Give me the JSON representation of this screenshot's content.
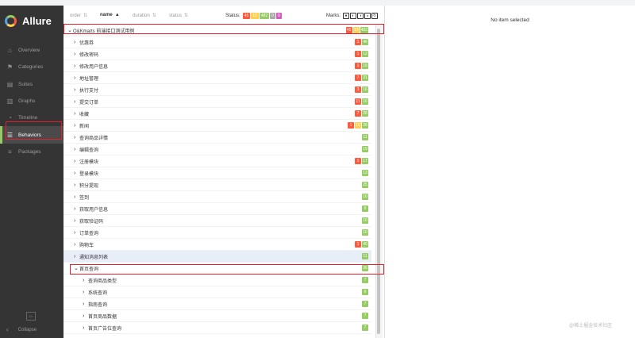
{
  "app": {
    "name": "Allure"
  },
  "sidebar": {
    "items": [
      {
        "label": "Overview",
        "icon": "home-icon"
      },
      {
        "label": "Categories",
        "icon": "flag-icon"
      },
      {
        "label": "Suites",
        "icon": "briefcase-icon"
      },
      {
        "label": "Graphs",
        "icon": "bar-chart-icon"
      },
      {
        "label": "Timeline",
        "icon": "clock-icon"
      },
      {
        "label": "Behaviors",
        "icon": "list-icon",
        "active": true
      },
      {
        "label": "Packages",
        "icon": "stack-icon"
      }
    ],
    "lang": "En",
    "collapse_label": "Collapse"
  },
  "header": {
    "order_label": "order",
    "name_label": "name",
    "duration_label": "duration",
    "status_col_label": "status",
    "status_label": "Status:",
    "status_counts": [
      "45",
      "10",
      "482",
      "0",
      "0"
    ],
    "marks_label": "Marks:"
  },
  "colors": {
    "failed": "#fd5a3e",
    "broken": "#ffd050",
    "passed": "#97cc64",
    "skipped": "#aaaaaa",
    "unknown": "#d35ebe",
    "accent": "#97cc64"
  },
  "tree": {
    "root": {
      "label": "O&Kmarts 前端接口测试用例",
      "counts": [
        "45",
        "10",
        "482"
      ]
    },
    "items": [
      {
        "label": "优惠券",
        "counts": [
          "1",
          "46"
        ]
      },
      {
        "label": "修改密码",
        "counts": [
          "1",
          "12"
        ]
      },
      {
        "label": "修改用户信息",
        "counts": [
          "1",
          "16"
        ]
      },
      {
        "label": "地址管理",
        "counts": [
          "7",
          "31"
        ]
      },
      {
        "label": "执行支付",
        "counts": [
          "3",
          "16"
        ]
      },
      {
        "label": "提交订单",
        "counts": [
          "11",
          "16"
        ]
      },
      {
        "label": "收藏",
        "counts": [
          "7",
          "28"
        ]
      },
      {
        "label": "新闻",
        "counts": [
          "1",
          "10",
          "28"
        ]
      },
      {
        "label": "查询商品详情",
        "counts": [
          "11"
        ]
      },
      {
        "label": "编辑查询",
        "counts": [
          "19"
        ]
      },
      {
        "label": "注册模块",
        "counts": [
          "1",
          "17"
        ]
      },
      {
        "label": "登录模块",
        "counts": [
          "13"
        ]
      },
      {
        "label": "积分提现",
        "counts": [
          "25"
        ]
      },
      {
        "label": "签到",
        "counts": [
          "10"
        ]
      },
      {
        "label": "获取用户信息",
        "counts": [
          "6"
        ]
      },
      {
        "label": "获取验证码",
        "counts": [
          "10"
        ]
      },
      {
        "label": "订单查询",
        "counts": [
          "10"
        ]
      },
      {
        "label": "购物车",
        "counts": [
          "1",
          "40"
        ]
      },
      {
        "label": "通知消息列表",
        "counts": [
          "11"
        ]
      },
      {
        "label": "首页查询",
        "counts": [
          "36"
        ],
        "expanded": true
      }
    ],
    "children": [
      {
        "label": "查询商品类型",
        "counts": [
          "7"
        ]
      },
      {
        "label": "系统查询",
        "counts": [
          "6"
        ]
      },
      {
        "label": "指南查询",
        "counts": [
          "7"
        ]
      },
      {
        "label": "首页商品数据",
        "counts": [
          "7"
        ]
      },
      {
        "label": "首页广告位查询",
        "counts": [
          "7"
        ]
      }
    ]
  },
  "detail": {
    "empty_text": "No item selected"
  },
  "watermark": "@稀土掘金技术社区"
}
